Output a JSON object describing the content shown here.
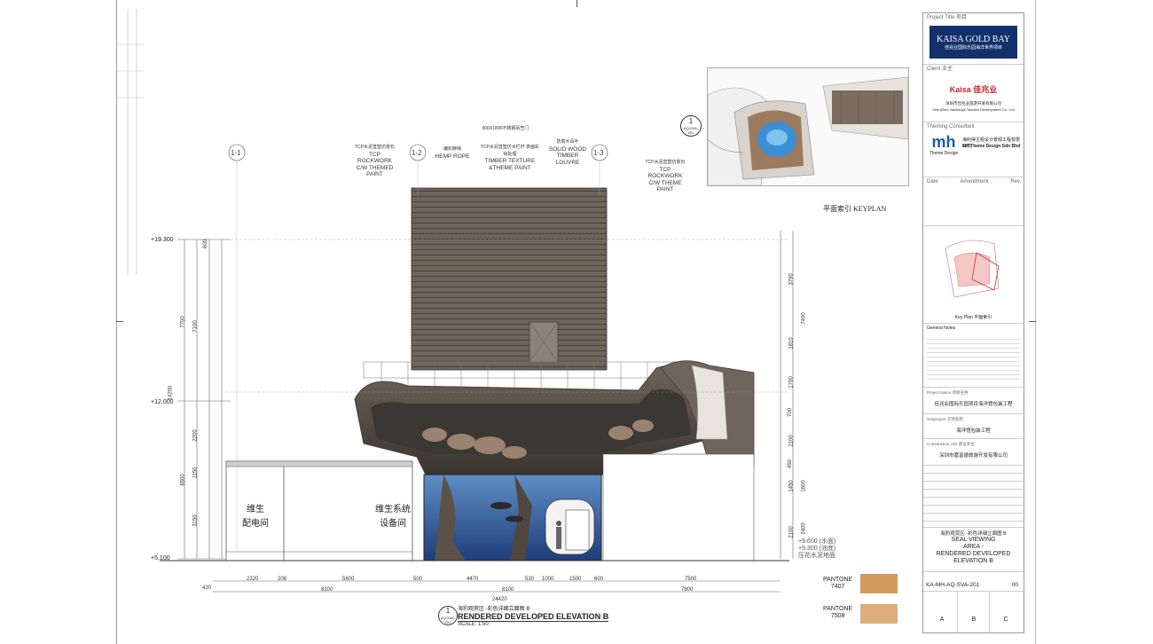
{
  "callouts": {
    "c1": {
      "cn": "TCP水泥直塑仿景石",
      "en": [
        "TCP",
        "ROCKWORK",
        "C/W THEMED",
        "PAINT"
      ]
    },
    "c2": {
      "cn": "编织麻绳",
      "en": [
        "HEMP ROPE"
      ]
    },
    "c3": {
      "cn": "TCP水泥直塑仿木栏杆 表面彩绘处理",
      "en": [
        "TIMBER TEXTURE",
        "&THEME PAINT"
      ]
    },
    "c4": {
      "cn": "防腐木百叶",
      "en": [
        "SOLID WOOD",
        "TIMBER",
        "LOUVRE"
      ]
    },
    "c5": {
      "cn": "TCP水泥直塑仿景石",
      "en": [
        "TCP",
        "ROCKWORK",
        "C/W THEME",
        "PAINT"
      ]
    },
    "top_note": "900X1800不锈钢吊笠门"
  },
  "grid_labels": [
    "1-1",
    "1-2",
    "1-3"
  ],
  "levels": [
    "+19.300",
    "+12.000",
    "+5.100"
  ],
  "level_notes": [
    "+9.600 (水面)",
    "+9.300 (池底)",
    "压花水泥地面"
  ],
  "rooms": [
    [
      "维生",
      "配电间"
    ],
    [
      "维生系统",
      "设备间"
    ]
  ],
  "left_dims": [
    "600",
    "7700",
    "7100",
    "14200",
    "2200",
    "6500",
    "1150",
    "3150"
  ],
  "right_dims": [
    "3790",
    "7400",
    "1810",
    "1700",
    "700",
    "2100",
    "450",
    "1450",
    "1600",
    "2100",
    "2400"
  ],
  "bottom_dims_row1": [
    "420",
    "2320",
    "208",
    "5600",
    "500",
    "4470",
    "530",
    "1000",
    "1500",
    "600",
    "7500"
  ],
  "bottom_dims_row2": [
    "8100",
    "8100",
    "7800"
  ],
  "bottom_total": "24420",
  "keyplan_label": "平面索引 KEYPLAN",
  "keyplan_marker": {
    "num": "1",
    "ref": "AQ-SVA-201"
  },
  "elevation_title": {
    "num": "1",
    "ref": "AQ-SVA-201",
    "cn": "海豹观赏区 -彩色详细立面图 B",
    "en": "RENDERED DEVELOPED ELEVATION B",
    "scale": "SCALE: 1:50"
  },
  "pantone": [
    {
      "label": "PANTONE\n7407",
      "color": "#cf9b5a"
    },
    {
      "label": "PANTONE\n7508",
      "color": "#dcae7c"
    }
  ],
  "title_block": {
    "project_title_label": "Project Title 项目",
    "project_name": "KAISA GOLD BAY",
    "project_name_cn": "佳兆业国际乐园海洋世界项目",
    "client_label": "Client 业主",
    "client_logo": "Kaisa 佳兆业",
    "client_cn": "深圳市佳兆业旅游开发有限公司",
    "client_en": "ShenZhen Jiazhaoye Tourism Development Co., Ltd",
    "consultant_label": "Theming Consultant",
    "consultant_logo": "mh",
    "consultant_logo_sub": "Theme Design",
    "consultant_cn": "海利得主题设计景观工程有限公司",
    "consultant_en": "MH Theme Design Sdn Bhd",
    "rev_headers": [
      "Date",
      "Amendment",
      "Rev"
    ],
    "keyplan_small": "Key Plan 平面索引",
    "notes_label": "General Notes",
    "project_label": "Project Name 项目名称",
    "project_value": "佳兆业国际乐园项目海洋馆包装工程",
    "subproject_label": "Subproject 子项名称",
    "subproject_value": "海洋馆包装工程",
    "construction_label": "Construction Unit 建设单位",
    "construction_value": "深圳市嘉富德旅游开发有限公司",
    "drawing_title_cn": "海豹观赏区 -彩色详细立面图 B",
    "drawing_title_en": [
      "SEAL VIEWING",
      "AREA -",
      "RENDERED DEVELOPED",
      "ELEVATION B"
    ],
    "drawing_no": "KA-MH-AQ-SVA-201",
    "rev_no": "00",
    "stamps": [
      "A",
      "B",
      "C"
    ]
  }
}
